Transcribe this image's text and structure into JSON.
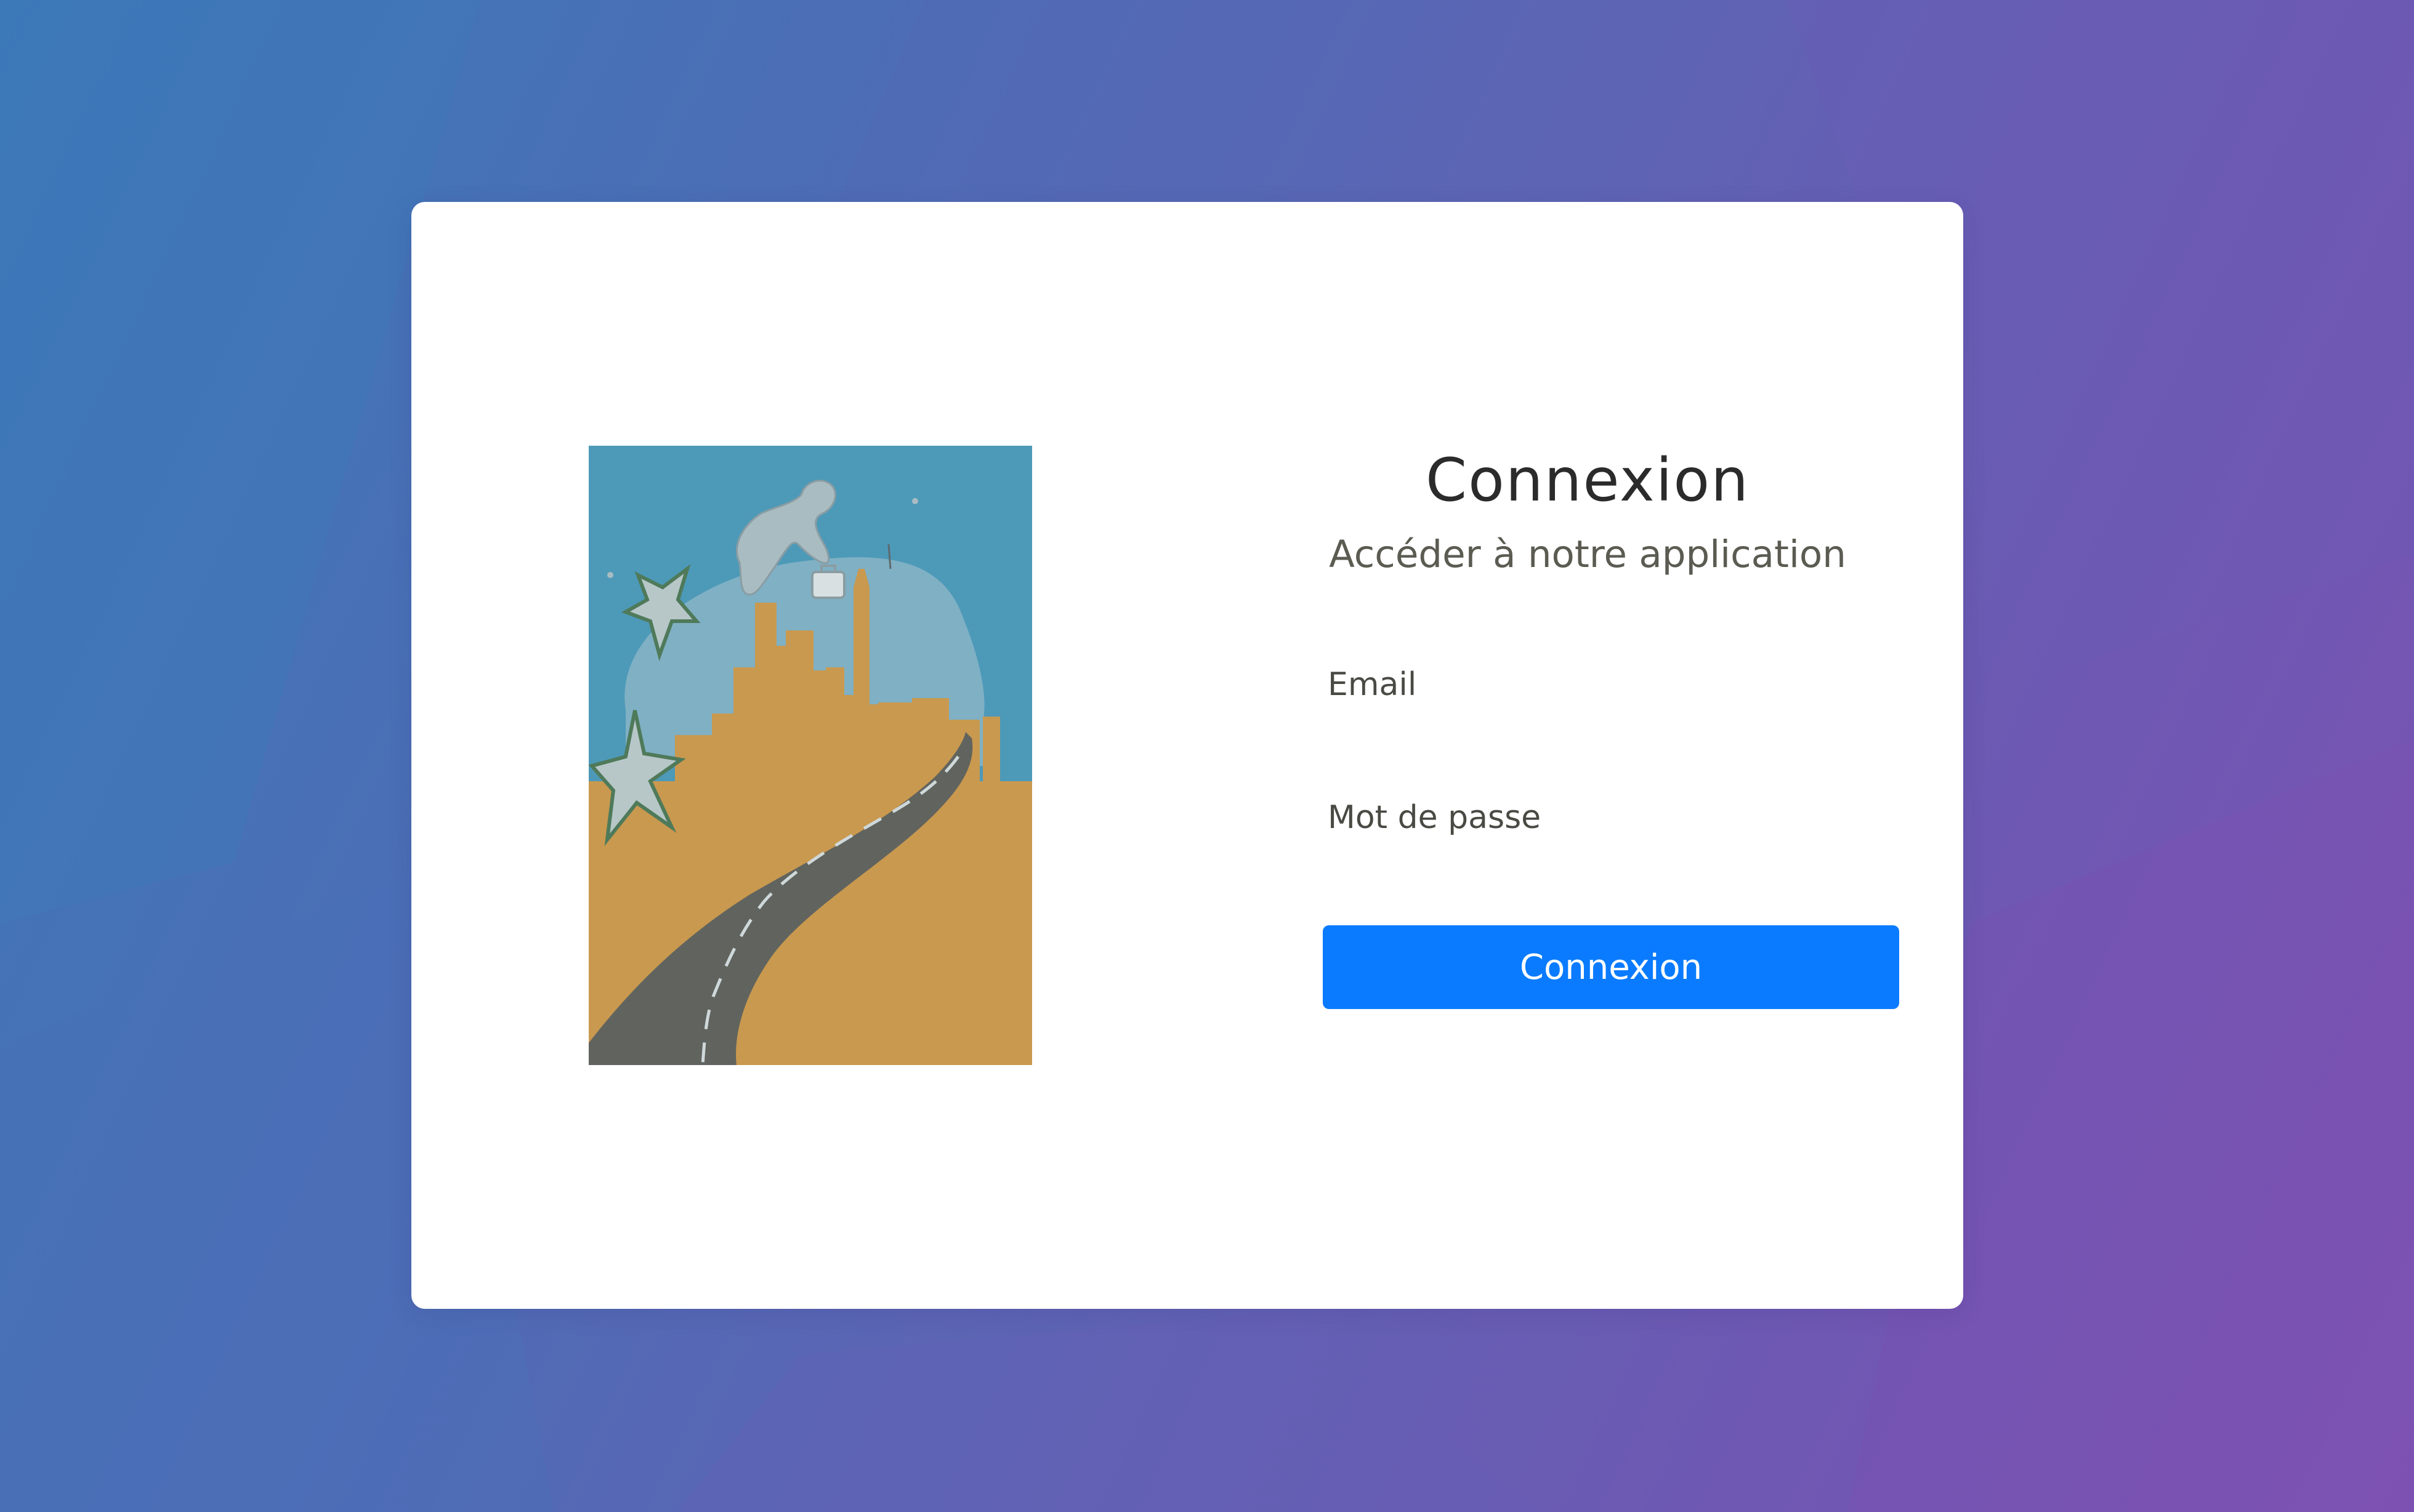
{
  "login": {
    "title": "Connexion",
    "subtitle": "Accéder à notre application",
    "email_label": "Email",
    "password_label": "Mot de passe",
    "submit_label": "Connexion"
  },
  "colors": {
    "background_start": "#3d78b8",
    "background_end": "#7d52b2",
    "card": "#ffffff",
    "button": "#0a7bff",
    "title_text": "#2b2b2b",
    "subtitle_text": "#5b5b52"
  },
  "illustration": {
    "icon": "city-road-stars-illustration"
  }
}
